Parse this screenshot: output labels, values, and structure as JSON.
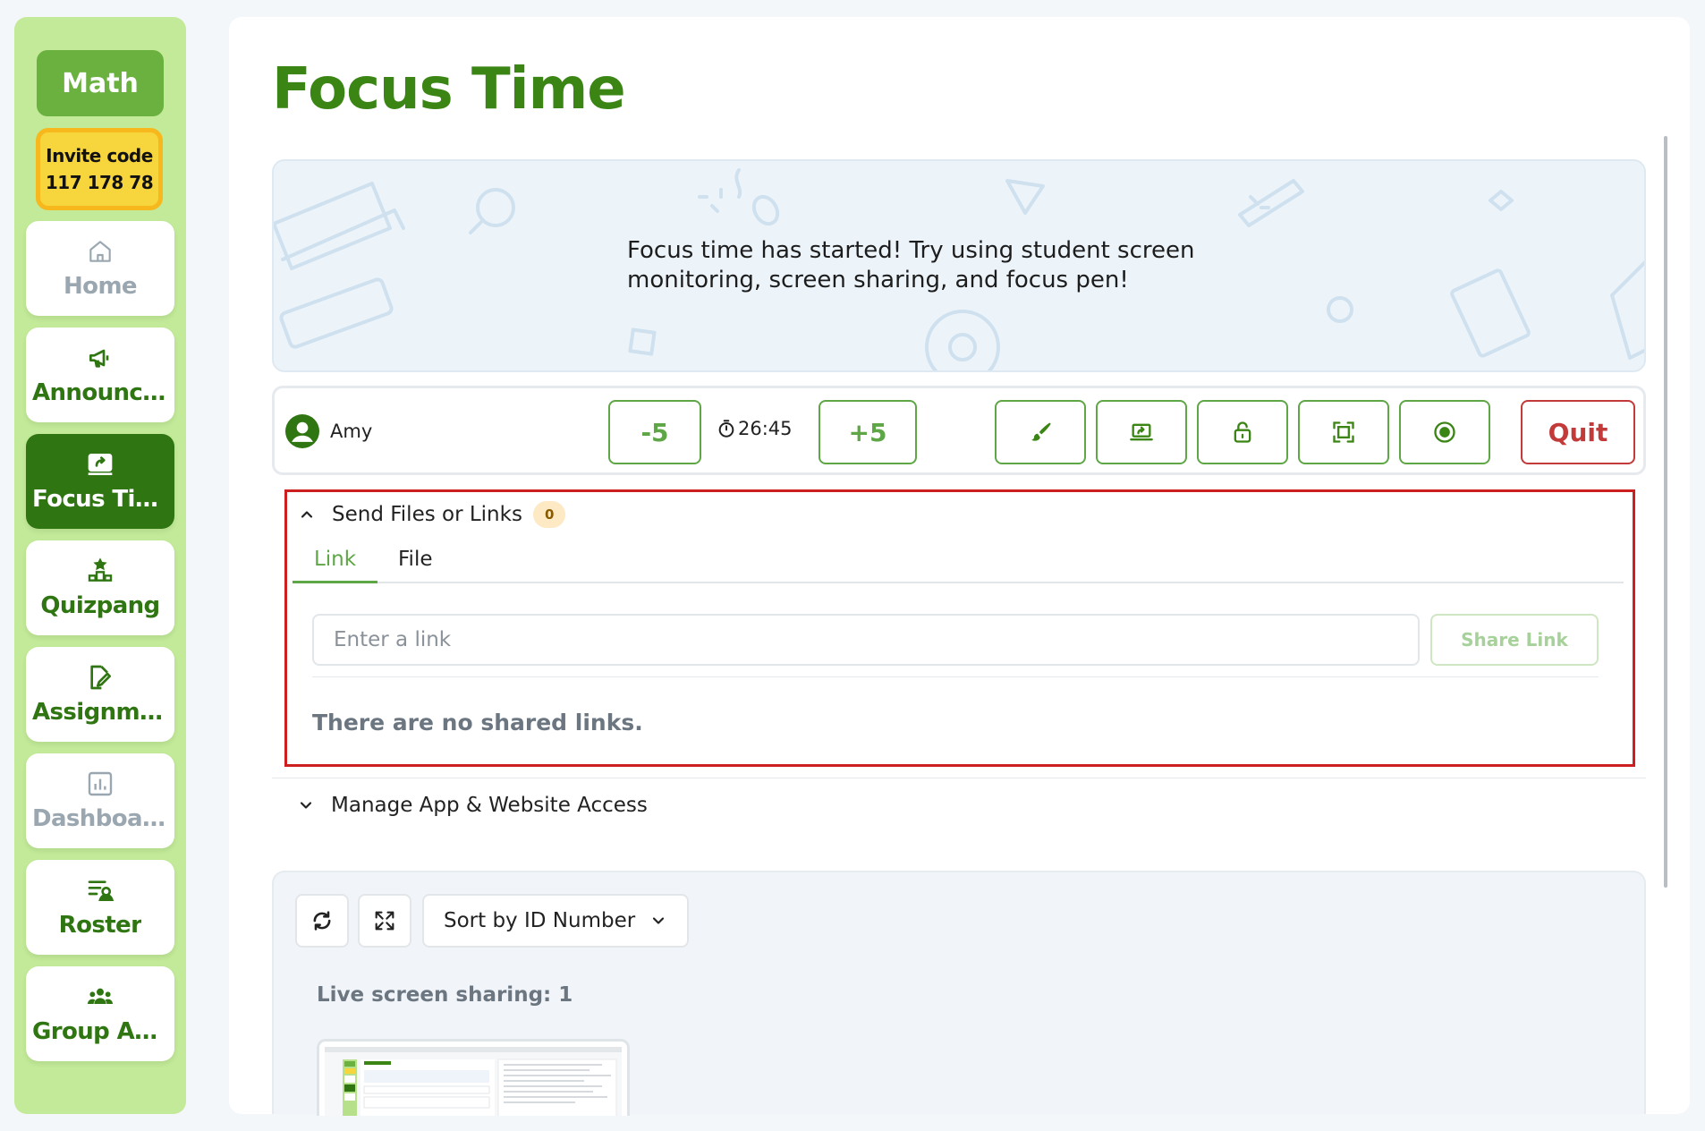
{
  "sidebar": {
    "class_name": "Math",
    "invite_label": "Invite code",
    "invite_code": "117 178 78",
    "items": [
      {
        "label": "Home",
        "icon": "home-icon"
      },
      {
        "label": "Announcements",
        "icon": "megaphone-icon"
      },
      {
        "label": "Focus Time",
        "icon": "screen-share-icon"
      },
      {
        "label": "Quizpang",
        "icon": "podium-icon"
      },
      {
        "label": "Assignments",
        "icon": "edit-document-icon"
      },
      {
        "label": "Dashboard",
        "icon": "bar-chart-icon"
      },
      {
        "label": "Roster",
        "icon": "roster-icon"
      },
      {
        "label": "Group Activities",
        "icon": "group-icon"
      }
    ]
  },
  "page": {
    "title": "Focus Time"
  },
  "banner": {
    "message": "Focus time has started! Try using student screen monitoring, screen sharing, and focus pen!"
  },
  "control_bar": {
    "student_name": "Amy",
    "minus_label": "-5",
    "timer": "26:45",
    "plus_label": "+5",
    "tool_icons": [
      "brush-icon",
      "screen-share-icon",
      "lock-icon",
      "fullscreen-icon",
      "target-icon"
    ],
    "quit_label": "Quit"
  },
  "files": {
    "header": "Send Files or Links",
    "count": "0",
    "tabs": [
      {
        "label": "Link",
        "active": true
      },
      {
        "label": "File",
        "active": false
      }
    ],
    "input_placeholder": "Enter a link",
    "share_label": "Share Link",
    "empty_message": "There are no shared links."
  },
  "access": {
    "header": "Manage App & Website Access"
  },
  "screens": {
    "sort_label": "Sort by ID Number",
    "live_label": "Live screen sharing: 1"
  },
  "colors": {
    "brand_green": "#3a8514",
    "accent_green": "#5fa646",
    "sidebar_bg": "#c2ea98",
    "quit_red": "#c23a3a",
    "invite_yellow": "#f7d53c",
    "highlight_red": "#cc1f1f"
  }
}
